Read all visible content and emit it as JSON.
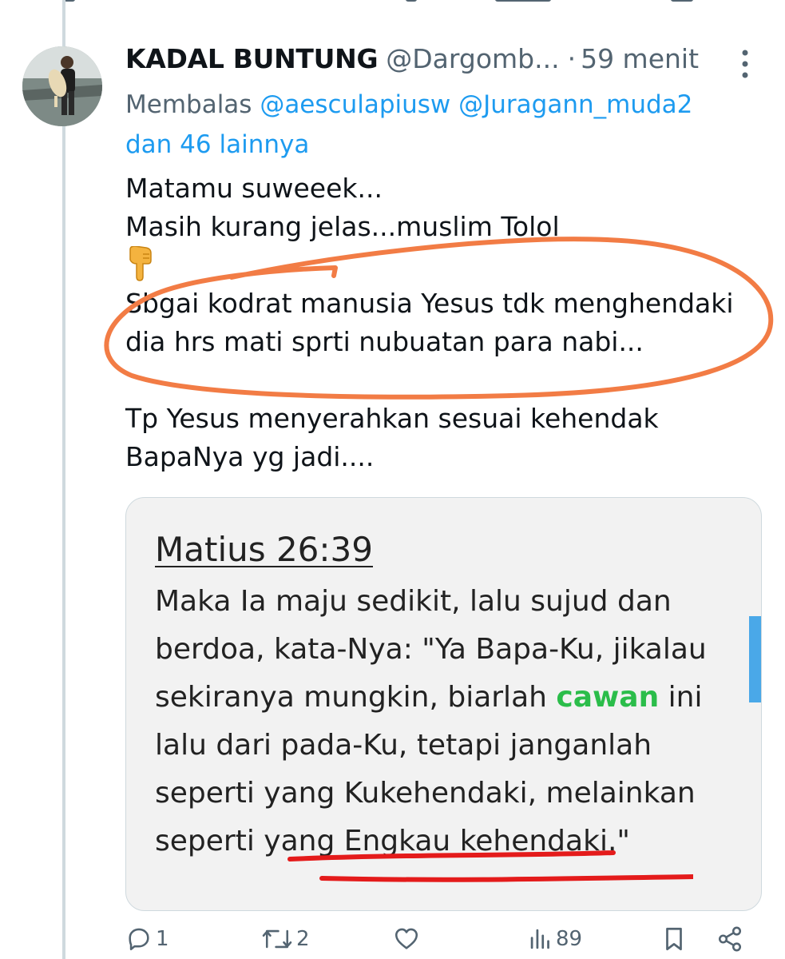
{
  "tweet": {
    "display_name": "KADAL BUNTUNG",
    "handle": "@Dargomb...",
    "separator": "·",
    "time": "59 menit",
    "reply_prefix": "Membalas",
    "reply_mention_1": "@aesculapiusw",
    "reply_mention_2": "@Juragann_muda2",
    "reply_others": "dan 46 lainnya",
    "text_lines": [
      "Matamu suweeek...",
      "Masih kurang jelas...muslim Tolol",
      "Sbgai kodrat manusia Yesus tdk menghendaki",
      "dia hrs mati sprti nubuatan para nabi...",
      "Tp Yesus menyerahkan sesuai kehendak",
      "BapaNya yg jadi...."
    ],
    "emoji": "👇"
  },
  "media": {
    "verse_title": "Matius 26:39",
    "verse_lines": [
      "Maka Ia maju sedikit, lalu sujud dan",
      "berdoa, kata-Nya: \"Ya Bapa-Ku, jikalau"
    ],
    "verse_line3_before": "sekiranya mungkin, biarlah ",
    "verse_highlight": "cawan",
    "verse_line3_after": " ini",
    "verse_lines_rest": [
      "lalu dari pada-Ku, tetapi janganlah",
      "seperti yang Kukehendaki, melainkan",
      "seperti yang Engkau kehendaki.\""
    ],
    "highlight_color": "#2bbd4a"
  },
  "actions": {
    "reply_count": "1",
    "retweet_count": "2",
    "like_count": "",
    "views_count": "89"
  },
  "colors": {
    "accent": "#1d9bf0",
    "secondary_text": "#536471",
    "annotation_orange": "#f27c45",
    "annotation_red": "#e41b1b"
  }
}
